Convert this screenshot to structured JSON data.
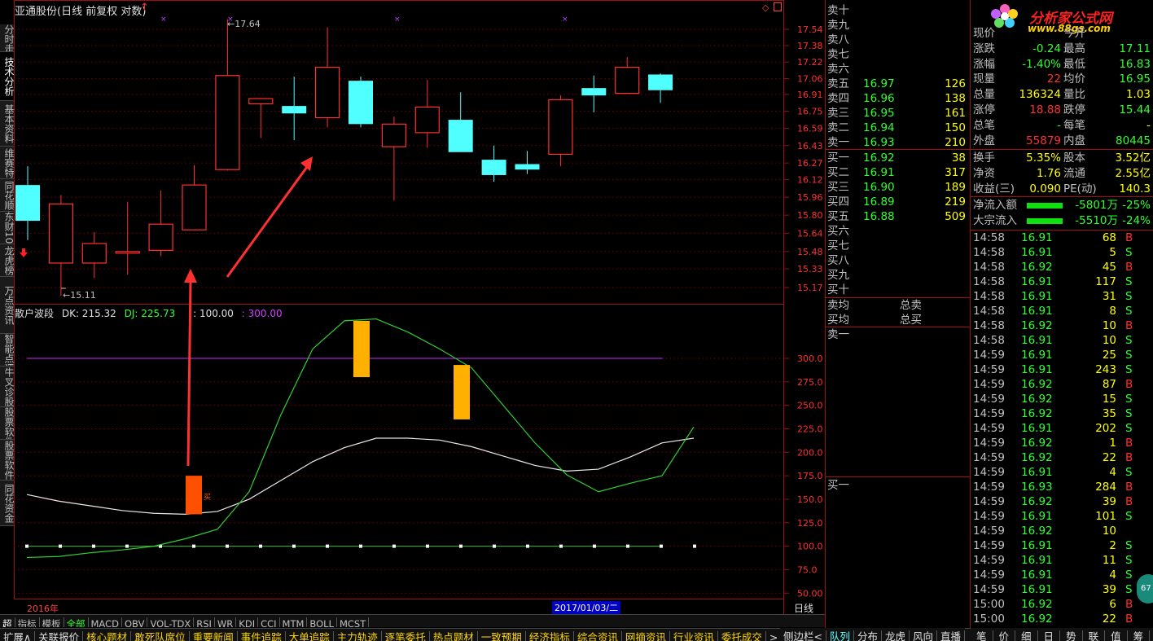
{
  "title": "亚通股份(日线 前复权 对数)",
  "left_tabs": [
    "分时走势",
    "技术分析",
    "基本资料",
    "维赛特",
    "同花顺",
    "东财10",
    "龙虎榜",
    "万点资讯",
    "智能点评",
    "牛叉诊股",
    "股票软件网",
    "股票软件",
    "同花资金"
  ],
  "left_active": 1,
  "kline": {
    "candles": [
      [
        16.07,
        15.75,
        16.24,
        15.58
      ],
      [
        15.38,
        15.9,
        15.98,
        15.1
      ],
      [
        15.38,
        15.55,
        15.65,
        15.25
      ],
      [
        15.47,
        15.48,
        15.92,
        15.28
      ],
      [
        15.49,
        15.72,
        16.02,
        15.44
      ],
      [
        15.67,
        16.07,
        16.25,
        15.67
      ],
      [
        16.21,
        17.09,
        17.64,
        16.2
      ],
      [
        16.82,
        16.87,
        16.86,
        16.5
      ],
      [
        16.8,
        16.73,
        17.08,
        16.48
      ],
      [
        16.69,
        17.17,
        17.56,
        16.6
      ],
      [
        17.04,
        16.63,
        17.08,
        16.6
      ],
      [
        16.42,
        16.63,
        16.7,
        15.93
      ],
      [
        16.55,
        16.79,
        17.05,
        16.41
      ],
      [
        16.67,
        16.37,
        16.93,
        16.37
      ],
      [
        16.3,
        16.16,
        16.43,
        16.1
      ],
      [
        16.26,
        16.21,
        16.38,
        16.17
      ],
      [
        16.35,
        16.86,
        16.9,
        16.24
      ],
      [
        16.97,
        16.9,
        17.09,
        16.74
      ],
      [
        16.92,
        17.17,
        17.27,
        16.92
      ],
      [
        17.1,
        16.95,
        17.11,
        16.83
      ]
    ],
    "price_ticks": [
      "17.54",
      "17.38",
      "17.22",
      "17.06",
      "16.91",
      "16.75",
      "16.59",
      "16.43",
      "16.27",
      "16.12",
      "15.96",
      "15.80",
      "15.64",
      "15.48",
      "15.33",
      "15.17"
    ],
    "high_label": "17.64",
    "low_label": "15.11",
    "marker_up": "↑"
  },
  "indicator": {
    "name": "散户波段",
    "dk_label": "DK: 215.32",
    "dj_label": "DJ: 225.73",
    "l1_label": ": 100.00",
    "l2_label": ": 300.00",
    "ticks": [
      "300.0",
      "275.0",
      "250.0",
      "225.0",
      "200.0",
      "175.0",
      "150.0",
      "125.0",
      "100.0",
      "75.0",
      "50.00"
    ],
    "dk": [
      155,
      148,
      143,
      138,
      135,
      134,
      137,
      150,
      170,
      190,
      205,
      215,
      215,
      213,
      206,
      196,
      186,
      180,
      182,
      195,
      210,
      215
    ],
    "dj": [
      88,
      89,
      93,
      96,
      100,
      108,
      118,
      158,
      240,
      310,
      340,
      342,
      328,
      310,
      290,
      250,
      210,
      176,
      158,
      167,
      175,
      227
    ],
    "buy_label": "买"
  },
  "date_left": "2016年",
  "date_right": "2017/01/03/二",
  "period": "日线",
  "indicator_tabs": [
    "指标",
    "模板",
    "全部",
    "MACD",
    "OBV",
    "VOL-TDX",
    "RSI",
    "WR",
    "KDJ",
    "CCI",
    "MTM",
    "BOLL",
    "MCST"
  ],
  "bottom_tabs": [
    "扩展∧",
    "关联报价",
    "核心题材",
    "敢死队席位",
    "重要新闻",
    "事件追踪",
    "大单追踪",
    "主力轨迹",
    "逐笔委托",
    "热点题材",
    "一致预期",
    "经济指标",
    "综合资讯",
    "网摘资讯",
    "行业资讯",
    "委托成交"
  ],
  "bottom_right_tabs": [
    "侧边栏<",
    "队列",
    "分布",
    "龙虎",
    "风向",
    "直播"
  ],
  "right_bottom_tabs": [
    "笔",
    "价",
    "细",
    "日",
    "势",
    "联",
    "值",
    "筹"
  ],
  "orderbook": {
    "sells": [
      {
        "l": "卖十",
        "p": "",
        "v": ""
      },
      {
        "l": "卖九",
        "p": "",
        "v": ""
      },
      {
        "l": "卖八",
        "p": "",
        "v": ""
      },
      {
        "l": "卖七",
        "p": "",
        "v": ""
      },
      {
        "l": "卖六",
        "p": "",
        "v": ""
      },
      {
        "l": "卖五",
        "p": "16.97",
        "v": "126"
      },
      {
        "l": "卖四",
        "p": "16.96",
        "v": "138"
      },
      {
        "l": "卖三",
        "p": "16.95",
        "v": "161"
      },
      {
        "l": "卖二",
        "p": "16.94",
        "v": "150"
      },
      {
        "l": "卖一",
        "p": "16.93",
        "v": "210"
      }
    ],
    "buys": [
      {
        "l": "买一",
        "p": "16.92",
        "v": "38"
      },
      {
        "l": "买二",
        "p": "16.91",
        "v": "317"
      },
      {
        "l": "买三",
        "p": "16.90",
        "v": "189"
      },
      {
        "l": "买四",
        "p": "16.89",
        "v": "219"
      },
      {
        "l": "买五",
        "p": "16.88",
        "v": "509"
      },
      {
        "l": "买六",
        "p": "",
        "v": ""
      },
      {
        "l": "买七",
        "p": "",
        "v": ""
      },
      {
        "l": "买八",
        "p": "",
        "v": ""
      },
      {
        "l": "买九",
        "p": "",
        "v": ""
      },
      {
        "l": "买十",
        "p": "",
        "v": ""
      }
    ],
    "avg_sell": "卖均",
    "total_sell": "总卖",
    "avg_buy": "买均",
    "total_buy": "总买",
    "sell1": "卖一",
    "buy1": "买一"
  },
  "brand": {
    "name": "分析家公式网",
    "url": "www.88gs.com"
  },
  "quote": [
    {
      "l1": "现价",
      "v1": "",
      "l2": "今开",
      "v2": ""
    },
    {
      "l1": "涨跌",
      "v1": "-0.24",
      "l2": "最高",
      "v2": "17.11"
    },
    {
      "l1": "涨幅",
      "v1": "-1.40%",
      "l2": "最低",
      "v2": "16.83"
    },
    {
      "l1": "现量",
      "v1": "22",
      "l2": "均价",
      "v2": "16.95"
    },
    {
      "l1": "总量",
      "v1": "136324",
      "l2": "量比",
      "v2": "1.03"
    },
    {
      "l1": "涨停",
      "v1": "18.88",
      "l2": "跌停",
      "v2": "15.44"
    },
    {
      "l1": "总笔",
      "v1": "-",
      "l2": "每笔",
      "v2": "-"
    },
    {
      "l1": "外盘",
      "v1": "55879",
      "l2": "内盘",
      "v2": "80445"
    },
    {
      "l1": "换手",
      "v1": "5.35%",
      "l2": "股本",
      "v2": "3.52亿"
    },
    {
      "l1": "净资",
      "v1": "1.76",
      "l2": "流通",
      "v2": "2.55亿"
    },
    {
      "l1": "收益(三)",
      "v1": "0.090",
      "l2": "PE(动)",
      "v2": "140.3"
    }
  ],
  "flow": [
    {
      "l": "净流入额",
      "v": "-5801万",
      "pct": "-25%"
    },
    {
      "l": "大宗流入",
      "v": "-5510万",
      "pct": "-24%"
    }
  ],
  "trades": [
    {
      "t": "14:58",
      "p": "16.91",
      "v": "68",
      "s": "B"
    },
    {
      "t": "14:58",
      "p": "16.91",
      "v": "5",
      "s": "S"
    },
    {
      "t": "14:58",
      "p": "16.92",
      "v": "45",
      "s": "B"
    },
    {
      "t": "14:58",
      "p": "16.91",
      "v": "117",
      "s": "S"
    },
    {
      "t": "14:58",
      "p": "16.91",
      "v": "31",
      "s": "S"
    },
    {
      "t": "14:58",
      "p": "16.91",
      "v": "8",
      "s": "S"
    },
    {
      "t": "14:58",
      "p": "16.92",
      "v": "10",
      "s": "B"
    },
    {
      "t": "14:58",
      "p": "16.91",
      "v": "10",
      "s": "S"
    },
    {
      "t": "14:59",
      "p": "16.91",
      "v": "25",
      "s": "S"
    },
    {
      "t": "14:59",
      "p": "16.91",
      "v": "243",
      "s": "S"
    },
    {
      "t": "14:59",
      "p": "16.92",
      "v": "87",
      "s": "B"
    },
    {
      "t": "14:59",
      "p": "16.92",
      "v": "15",
      "s": "S"
    },
    {
      "t": "14:59",
      "p": "16.92",
      "v": "35",
      "s": "S"
    },
    {
      "t": "14:59",
      "p": "16.91",
      "v": "202",
      "s": "S"
    },
    {
      "t": "14:59",
      "p": "16.92",
      "v": "1",
      "s": "B"
    },
    {
      "t": "14:59",
      "p": "16.92",
      "v": "22",
      "s": "B"
    },
    {
      "t": "14:59",
      "p": "16.91",
      "v": "4",
      "s": "S"
    },
    {
      "t": "14:59",
      "p": "16.93",
      "v": "284",
      "s": "B"
    },
    {
      "t": "14:59",
      "p": "16.92",
      "v": "39",
      "s": "B"
    },
    {
      "t": "14:59",
      "p": "16.91",
      "v": "101",
      "s": "S"
    },
    {
      "t": "14:59",
      "p": "16.92",
      "v": "10",
      "s": ""
    },
    {
      "t": "14:59",
      "p": "16.91",
      "v": "2",
      "s": "S"
    },
    {
      "t": "14:59",
      "p": "16.91",
      "v": "11",
      "s": "S"
    },
    {
      "t": "14:59",
      "p": "16.91",
      "v": "4",
      "s": "S"
    },
    {
      "t": "14:59",
      "p": "16.91",
      "v": "39",
      "s": "S"
    },
    {
      "t": "15:00",
      "p": "16.92",
      "v": "6",
      "s": "B"
    },
    {
      "t": "15:00",
      "p": "16.92",
      "v": "22",
      "s": "B"
    }
  ],
  "side_badge": "67",
  "colors": {
    "up": "#ff3030",
    "down": "#50ffff",
    "buy": "#ff3030",
    "sell": "#30ff30"
  }
}
